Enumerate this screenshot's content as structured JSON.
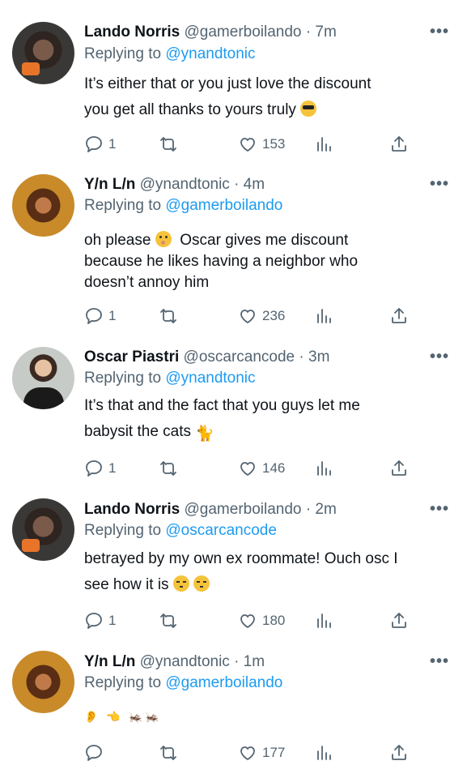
{
  "tweets": [
    {
      "name": "Lando Norris",
      "handle": "@gamerboilando · 7m",
      "replying_prefix": "Replying to ",
      "replying_to": "@ynandtonic",
      "text_lines": [
        "It’s either that or you just love the discount",
        "you get all thanks to yours truly"
      ],
      "replies": "1",
      "likes": "153"
    },
    {
      "name": "Y/n L/n",
      "handle": "@ynandtonic · 4m",
      "replying_prefix": "Replying to ",
      "replying_to": "@gamerboilando",
      "text_lines": [
        "oh please",
        "Oscar gives me discount",
        "because he likes having a neighbor who",
        "doesn’t annoy him"
      ],
      "replies": "1",
      "likes": "236"
    },
    {
      "name": "Oscar Piastri",
      "handle": "@oscarcancode · 3m",
      "replying_prefix": "Replying to ",
      "replying_to": "@ynandtonic",
      "text_lines": [
        "It’s that and the fact that you guys let me",
        "babysit the cats"
      ],
      "replies": "1",
      "likes": "146"
    },
    {
      "name": "Lando Norris",
      "handle": "@gamerboilando · 2m",
      "replying_prefix": "Replying to ",
      "replying_to": "@oscarcancode",
      "text_lines": [
        "betrayed by my own ex roommate! Ouch osc I",
        "see how it is"
      ],
      "replies": "1",
      "likes": "180"
    },
    {
      "name": "Y/n L/n",
      "handle": "@ynandtonic · 1m",
      "replying_prefix": "Replying to ",
      "replying_to": "@gamerboilando",
      "text_lines": [
        "👂 👈 🦗🦗"
      ],
      "replies": "",
      "likes": "177"
    }
  ],
  "icons": {
    "more": "ellipsis-icon",
    "reply": "reply-icon",
    "retweet": "retweet-icon",
    "like": "heart-icon",
    "views": "views-icon",
    "share": "share-icon"
  },
  "colors": {
    "link": "#1d9bf0",
    "muted": "#536471",
    "text": "#0f1419"
  }
}
